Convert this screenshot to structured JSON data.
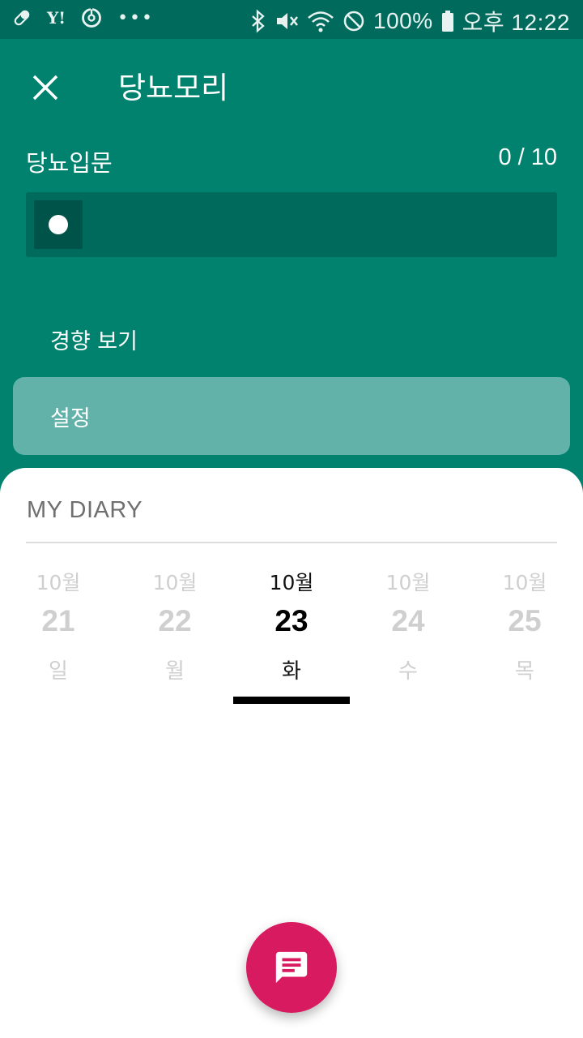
{
  "status_bar": {
    "left_icons": [
      "pill-icon",
      "yahoo-icon",
      "sync-icon",
      "more-dots-icon"
    ],
    "right_icons": [
      "bluetooth-icon",
      "mute-icon",
      "wifi-icon",
      "do-not-disturb-icon",
      "battery-icon"
    ],
    "battery": "100%",
    "time": "오후 12:22"
  },
  "header": {
    "title": "당뇨모리",
    "close_icon": "close-icon"
  },
  "program": {
    "name": "당뇨입문",
    "progress_text": "0 / 10",
    "progress_value": 0
  },
  "menu": [
    {
      "label": "경향 보기",
      "selected": false
    },
    {
      "label": "설정",
      "selected": true
    }
  ],
  "diary": {
    "title": "MY DIARY",
    "dates": [
      {
        "month": "10월",
        "day": "21",
        "weekday": "일",
        "selected": false
      },
      {
        "month": "10월",
        "day": "22",
        "weekday": "월",
        "selected": false
      },
      {
        "month": "10월",
        "day": "23",
        "weekday": "화",
        "selected": true
      },
      {
        "month": "10월",
        "day": "24",
        "weekday": "수",
        "selected": false
      },
      {
        "month": "10월",
        "day": "25",
        "weekday": "목",
        "selected": false
      }
    ]
  },
  "fab": {
    "icon": "message-icon",
    "color": "#d81b60"
  },
  "colors": {
    "primary": "#00826f",
    "status_bar": "#006b5c",
    "selected_menu": "#62b2aa"
  }
}
